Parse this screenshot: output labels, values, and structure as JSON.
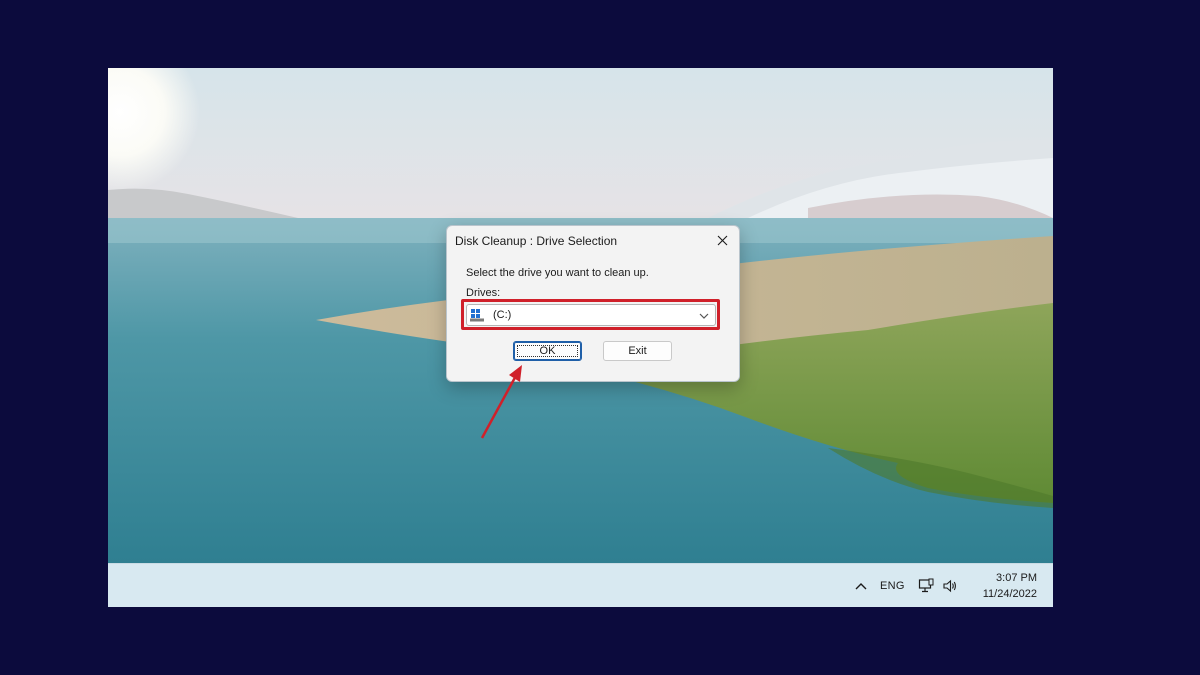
{
  "dialog": {
    "title": "Disk Cleanup : Drive Selection",
    "prompt": "Select the drive you want to clean up.",
    "drives_label": "Drives:",
    "selected_drive": "(C:)",
    "ok_label": "OK",
    "exit_label": "Exit",
    "close_icon": "close-icon",
    "drive_icon": "windows-drive-icon",
    "dropdown_icon": "chevron-down-icon"
  },
  "taskbar": {
    "language": "ENG",
    "time": "3:07 PM",
    "date": "11/24/2022",
    "icons": [
      "chevron-up-icon",
      "network-icon",
      "speaker-icon"
    ]
  },
  "annotation": {
    "highlight_color": "#d0202a",
    "arrow_color": "#d0202a"
  }
}
